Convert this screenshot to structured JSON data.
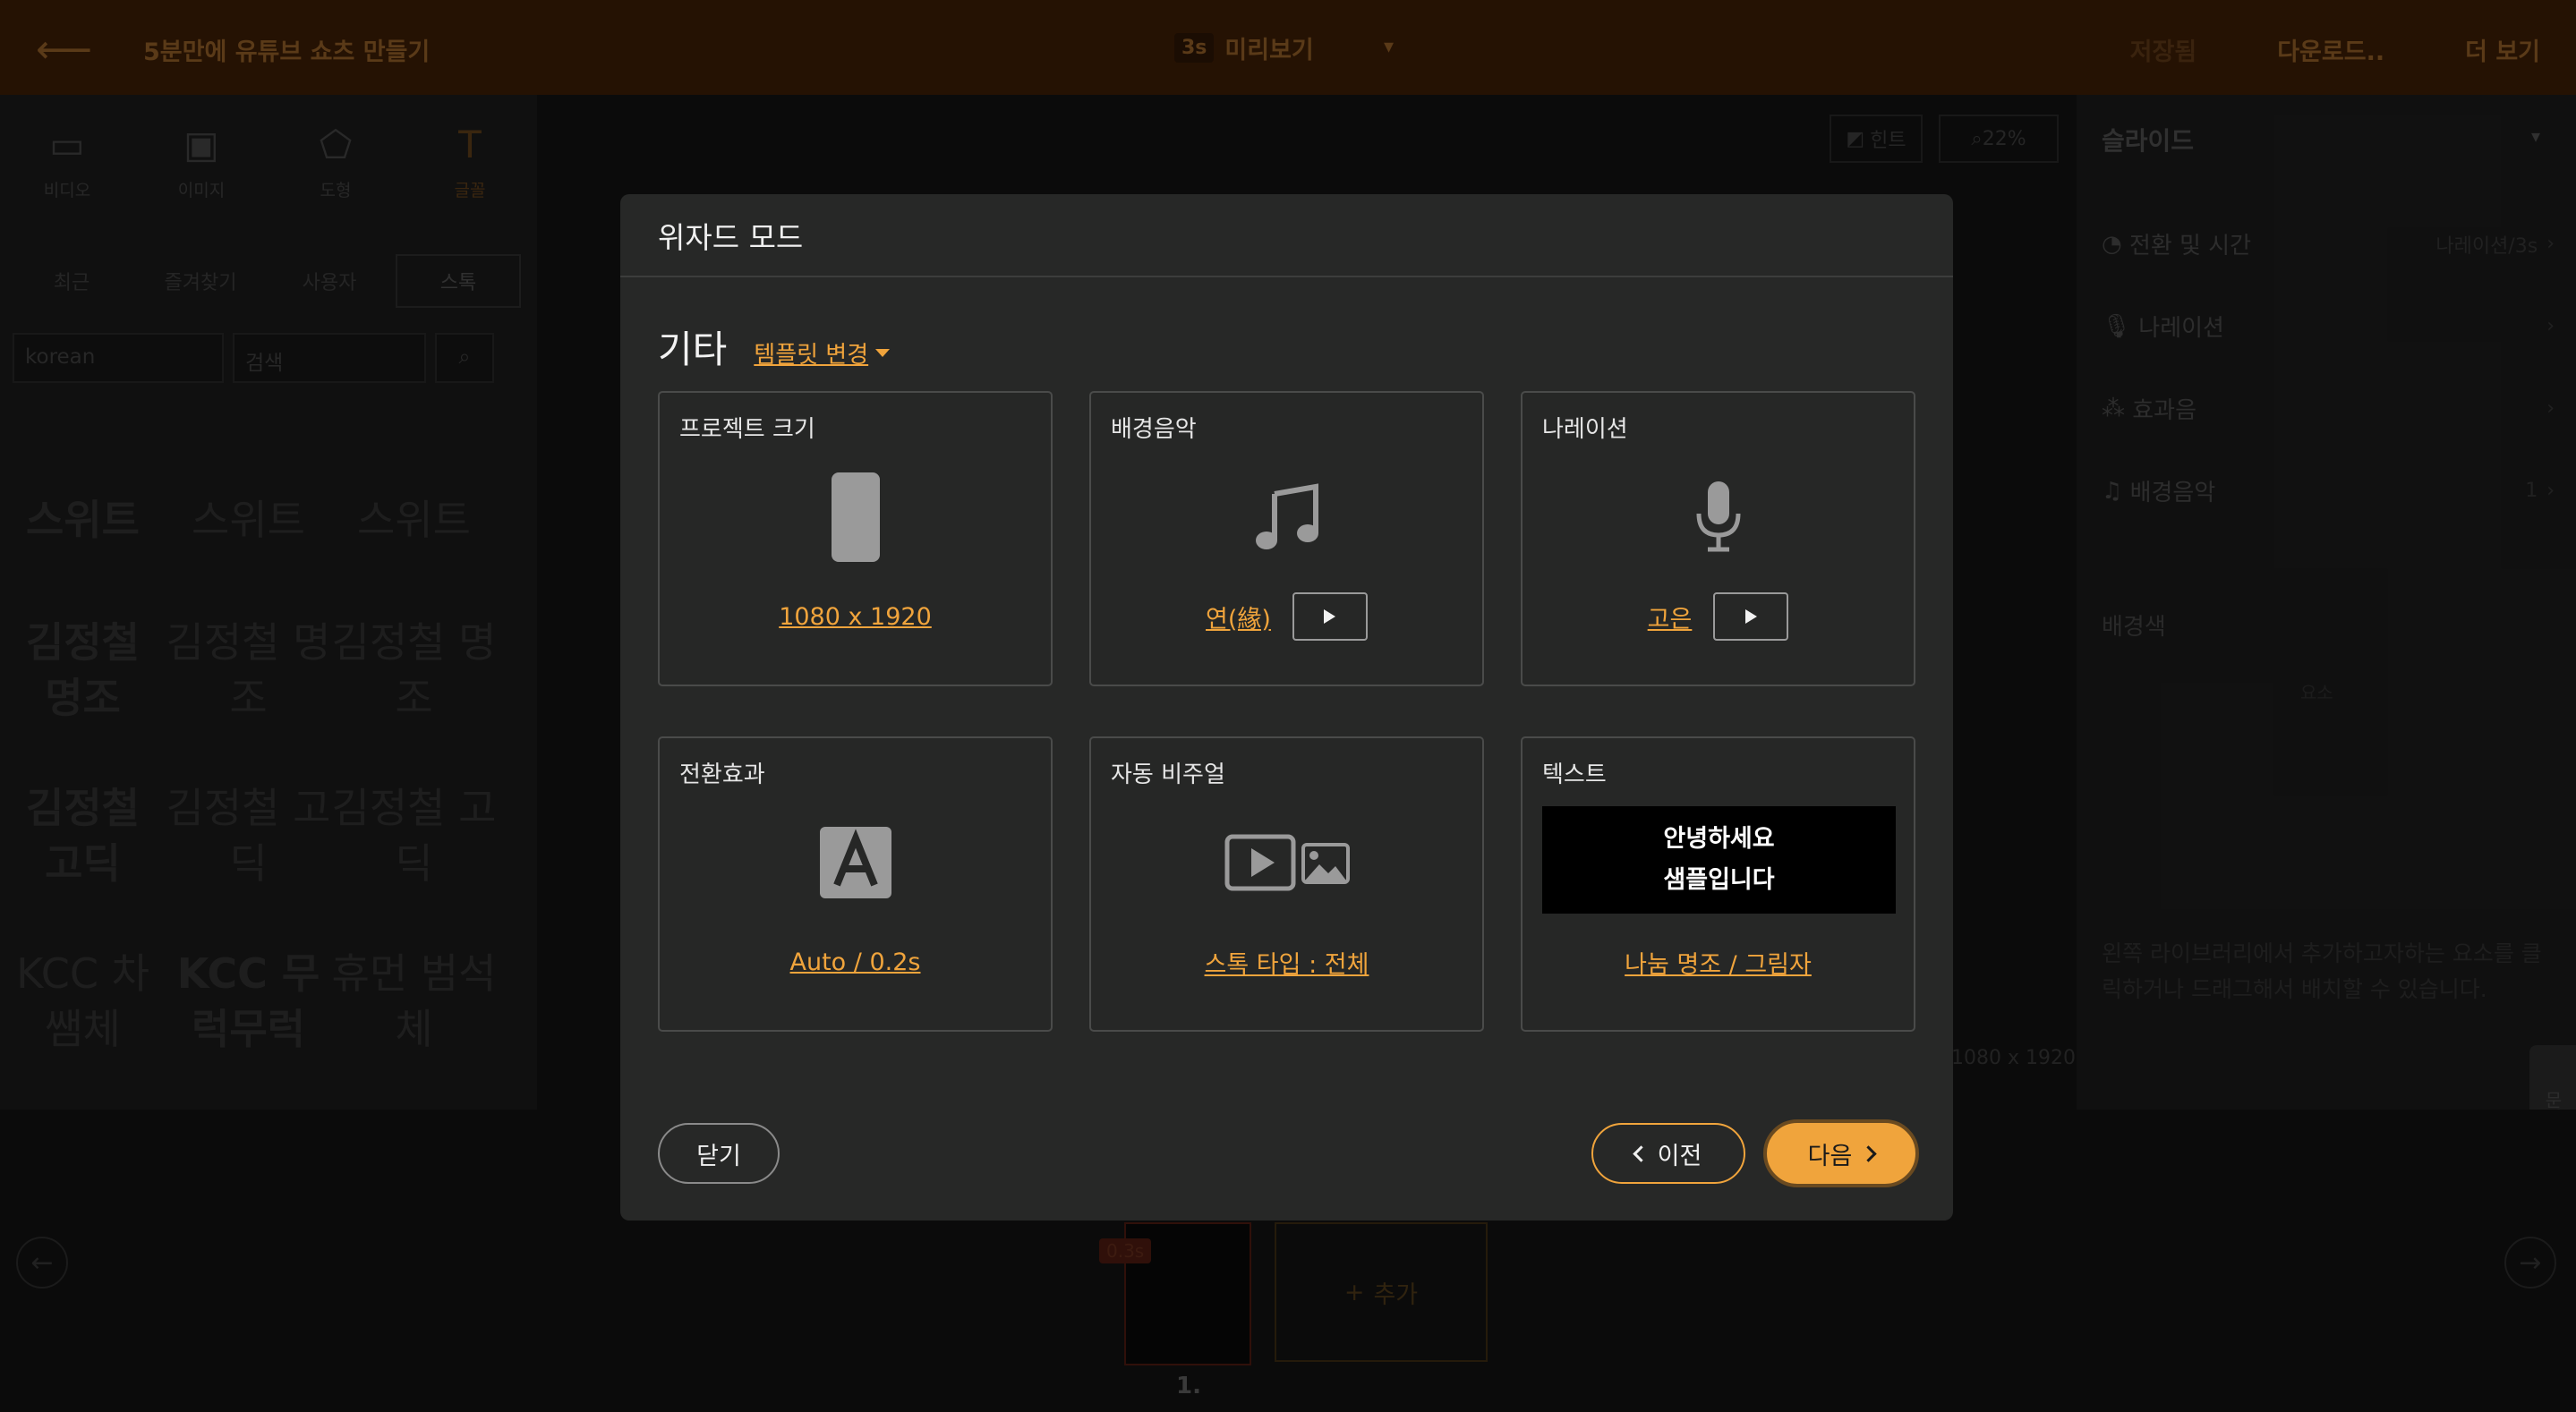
{
  "topbar": {
    "project_title": "5분만에 유튜브 쇼츠 만들기",
    "duration_badge": "3s",
    "preview_label": "미리보기",
    "save_label": "저장됨",
    "download_label": "다운로드..",
    "more_label": "더 보기"
  },
  "left_panel": {
    "tool_tabs": [
      {
        "label": "비디오",
        "icon": "video-icon"
      },
      {
        "label": "이미지",
        "icon": "image-icon"
      },
      {
        "label": "도형",
        "icon": "shape-icon"
      },
      {
        "label": "글꼴",
        "icon": "text-icon"
      }
    ],
    "sub_tabs": [
      "최근",
      "즐겨찾기",
      "사용자",
      "스톡"
    ],
    "language_filter": "korean",
    "search_placeholder": "검색",
    "fonts": [
      "스위트",
      "스위트",
      "스위트",
      "김정철 명조",
      "김정철 명조",
      "김정철 명조",
      "김정철 고딕",
      "김정철 고딕",
      "김정철 고딕",
      "KCC 차쌤체",
      "KCC 무럭무럭",
      "휴먼 범석체"
    ]
  },
  "canvas": {
    "hint_label": "힌트",
    "zoom_label": "22%",
    "size_label": "1080 x 1920"
  },
  "right_panel": {
    "title": "슬라이드",
    "rows": [
      {
        "label": "전환 및 시간",
        "value": "나레이션/3s",
        "icon": "clock-icon"
      },
      {
        "label": "나레이션",
        "value": "",
        "icon": "mic-icon"
      },
      {
        "label": "효과음",
        "value": "",
        "icon": "sound-icon"
      },
      {
        "label": "배경음악",
        "value": "1",
        "icon": "music-icon"
      }
    ],
    "bg_color_label": "배경색",
    "elements_label": "요소",
    "hint_text": "왼쪽 라이브러리에서 추가하고자하는 요소를 클릭하거나 드래그해서 배치할 수 있습니다.",
    "inquiry_label": "문의"
  },
  "timeline": {
    "slide_badge": "0.3s",
    "slide_number": "1.",
    "add_label": "추가"
  },
  "modal": {
    "title": "위자드 모드",
    "section_title": "기타",
    "template_change_label": "템플릿 변경",
    "cards": {
      "project_size": {
        "title": "프로젝트 크기",
        "value": "1080 x 1920"
      },
      "bgm": {
        "title": "배경음악",
        "value": "연(緣)"
      },
      "narration": {
        "title": "나레이션",
        "value": "고은"
      },
      "transition": {
        "title": "전환효과",
        "value": "Auto / 0.2s"
      },
      "auto_visual": {
        "title": "자동 비주얼",
        "value": "스톡 타입 : 전체"
      },
      "text": {
        "title": "텍스트",
        "sample_line1": "안녕하세요",
        "sample_line2": "샘플입니다",
        "value": "나눔 명조 / 그림자"
      }
    },
    "close_label": "닫기",
    "prev_label": "이전",
    "next_label": "다음"
  },
  "colors": {
    "accent": "#f0a43c",
    "modal_bg": "#272827",
    "topbar_bg": "#3a1d06"
  }
}
